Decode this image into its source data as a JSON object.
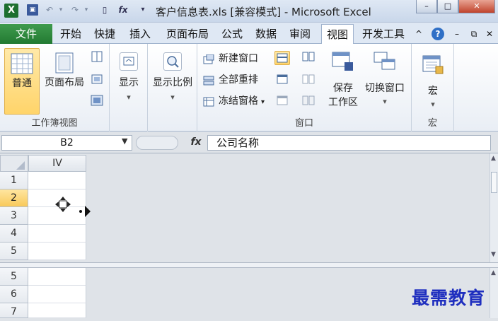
{
  "app": {
    "title": "客户信息表.xls [兼容模式] - Microsoft Excel",
    "window_buttons": [
      "–",
      "□",
      "✕"
    ]
  },
  "quick_access": [
    "save-icon",
    "undo-icon",
    "redo-icon",
    "new-doc-icon",
    "fx-icon",
    "customize-icon"
  ],
  "menu": {
    "file_label": "文件",
    "tabs": [
      "开始",
      "快捷",
      "插入",
      "页面布局",
      "公式",
      "数据",
      "审阅",
      "视图",
      "开发工具"
    ],
    "active_tab": "视图",
    "right_icons": [
      "^",
      "?",
      "–",
      "⧉",
      "✕"
    ]
  },
  "ribbon": {
    "workbook_views": {
      "normal_label": "普通",
      "page_layout_label": "页面布局",
      "group_label": "工作簿视图"
    },
    "show": {
      "label": "显示",
      "dropdown": "▾"
    },
    "zoom": {
      "label": "显示比例",
      "dropdown": "▾"
    },
    "window": {
      "new_window_label": "新建窗口",
      "arrange_all_label": "全部重排",
      "freeze_panes_label": "冻结窗格",
      "freeze_dropdown": "▾",
      "save_workspace_line1": "保存",
      "save_workspace_line2": "工作区",
      "switch_window_label": "切换窗口",
      "switch_dropdown": "▾",
      "group_label": "窗口"
    },
    "macros": {
      "label": "宏",
      "dropdown": "▾",
      "group_label": "宏"
    }
  },
  "formula_bar": {
    "name_box": "B2",
    "fx_label": "fx",
    "value": "公司名称"
  },
  "sheet": {
    "column_header": "IV",
    "top_rows": [
      "1",
      "2",
      "3",
      "4",
      "5"
    ],
    "bottom_rows": [
      "5",
      "6",
      "7"
    ],
    "active_row": "2"
  },
  "watermark": "最需教育"
}
